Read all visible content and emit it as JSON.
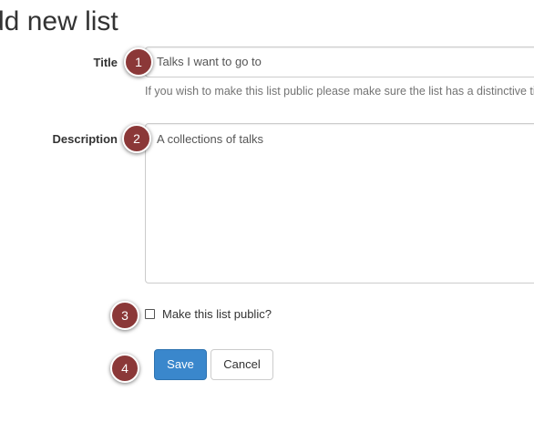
{
  "page": {
    "title": "dd new list"
  },
  "form": {
    "title_label": "Title",
    "title_value": "Talks I want to go to",
    "title_help": "If you wish to make this list public please make sure the list has a distinctive title",
    "description_label": "Description",
    "description_value": "A collections of talks",
    "public_checkbox_label": "Make this list public?",
    "public_checked": false,
    "save_label": "Save",
    "cancel_label": "Cancel"
  },
  "callouts": [
    "1",
    "2",
    "3",
    "4"
  ],
  "colors": {
    "primary_button": "#3a87cc",
    "callout": "#8b3838"
  }
}
